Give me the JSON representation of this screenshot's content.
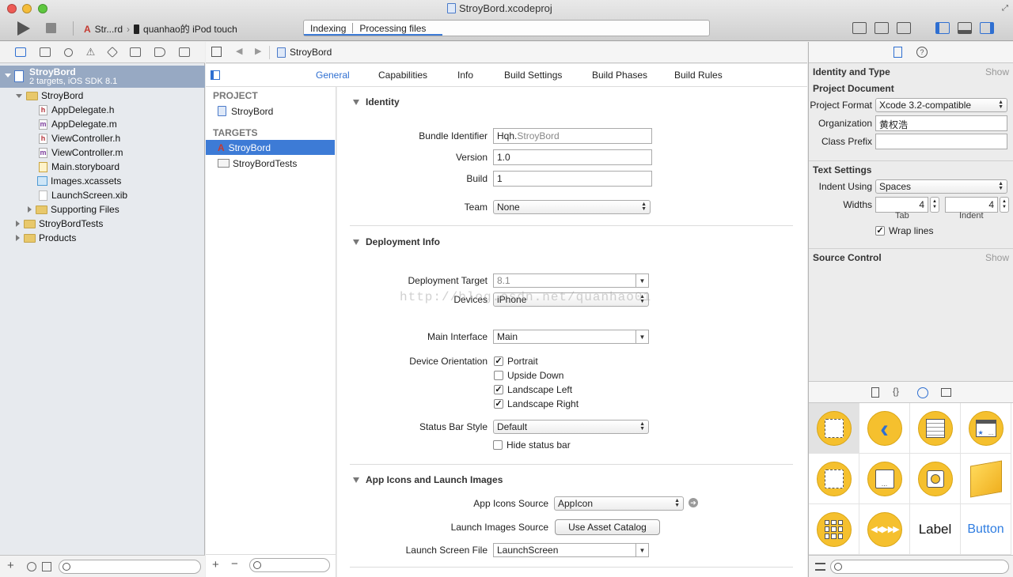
{
  "window": {
    "title": "StroyBord.xcodeproj"
  },
  "toolbar": {
    "scheme_name": "Str...rd",
    "device_name": "quanhao的 iPod touch",
    "activity_status": "Indexing",
    "activity_detail": "Processing files"
  },
  "navigator": {
    "project_name": "StroyBord",
    "project_subtitle": "2 targets, iOS SDK 8.1",
    "items": [
      {
        "label": "StroyBord",
        "type": "folder",
        "open": true
      },
      {
        "label": "AppDelegate.h",
        "type": "h"
      },
      {
        "label": "AppDelegate.m",
        "type": "m"
      },
      {
        "label": "ViewController.h",
        "type": "h"
      },
      {
        "label": "ViewController.m",
        "type": "m"
      },
      {
        "label": "Main.storyboard",
        "type": "storyboard"
      },
      {
        "label": "Images.xcassets",
        "type": "xcassets"
      },
      {
        "label": "LaunchScreen.xib",
        "type": "xib"
      },
      {
        "label": "Supporting Files",
        "type": "folder",
        "open": false
      },
      {
        "label": "StroyBordTests",
        "type": "folder",
        "open": false
      },
      {
        "label": "Products",
        "type": "folder",
        "open": false
      }
    ]
  },
  "editor": {
    "breadcrumb": "StroyBord",
    "tabs": [
      "General",
      "Capabilities",
      "Info",
      "Build Settings",
      "Build Phases",
      "Build Rules"
    ],
    "selected_tab": "General",
    "project_header": "PROJECT",
    "project_item": "StroyBord",
    "targets_header": "TARGETS",
    "targets": [
      "StroyBord",
      "StroyBordTests"
    ],
    "selected_target": "StroyBord"
  },
  "identity": {
    "section_title": "Identity",
    "bundle_identifier_label": "Bundle Identifier",
    "bundle_prefix": "Hqh.",
    "bundle_suffix": "StroyBord",
    "version_label": "Version",
    "version": "1.0",
    "build_label": "Build",
    "build": "1",
    "team_label": "Team",
    "team": "None"
  },
  "deployment": {
    "section_title": "Deployment Info",
    "target_label": "Deployment Target",
    "target": "8.1",
    "devices_label": "Devices",
    "devices": "iPhone",
    "main_interface_label": "Main Interface",
    "main_interface": "Main",
    "orientation_label": "Device Orientation",
    "orientations": [
      {
        "label": "Portrait",
        "checked": true
      },
      {
        "label": "Upside Down",
        "checked": false
      },
      {
        "label": "Landscape Left",
        "checked": true
      },
      {
        "label": "Landscape Right",
        "checked": true
      }
    ],
    "status_bar_label": "Status Bar Style",
    "status_bar": "Default",
    "hide_status_bar_label": "Hide status bar",
    "hide_status_bar": false
  },
  "app_icons": {
    "section_title": "App Icons and Launch Images",
    "icons_source_label": "App Icons Source",
    "icons_source": "AppIcon",
    "launch_images_label": "Launch Images Source",
    "launch_images_button": "Use Asset Catalog",
    "launch_screen_label": "Launch Screen File",
    "launch_screen": "LaunchScreen"
  },
  "watermark": "http://blog.csdn.net/quanhao01",
  "inspector": {
    "identity_type_title": "Identity and Type",
    "show_label": "Show",
    "project_document_title": "Project Document",
    "project_format_label": "Project Format",
    "project_format": "Xcode 3.2-compatible",
    "organization_label": "Organization",
    "organization": "黄权浩",
    "class_prefix_label": "Class Prefix",
    "class_prefix": "",
    "text_settings_title": "Text Settings",
    "indent_using_label": "Indent Using",
    "indent_using": "Spaces",
    "widths_label": "Widths",
    "tab_width": "4",
    "indent_width": "4",
    "tab_caption": "Tab",
    "indent_caption": "Indent",
    "wrap_lines_label": "Wrap lines",
    "wrap_lines": true,
    "source_control_title": "Source Control"
  },
  "library": {
    "items": [
      {
        "name": "view-controller-icon"
      },
      {
        "name": "navigation-controller-icon"
      },
      {
        "name": "table-view-controller-icon"
      },
      {
        "name": "collection-view-controller-icon"
      },
      {
        "name": "page-view-controller-icon"
      },
      {
        "name": "split-view-controller-icon"
      },
      {
        "name": "glkit-view-controller-icon"
      },
      {
        "name": "object-icon"
      },
      {
        "name": "collection-icon"
      },
      {
        "name": "av-player-icon"
      },
      {
        "name": "label-item",
        "text": "Label"
      },
      {
        "name": "button-item",
        "text": "Button"
      }
    ]
  },
  "colors": {
    "accent": "#3d7bd6",
    "library_yellow": "#f5c02e"
  }
}
